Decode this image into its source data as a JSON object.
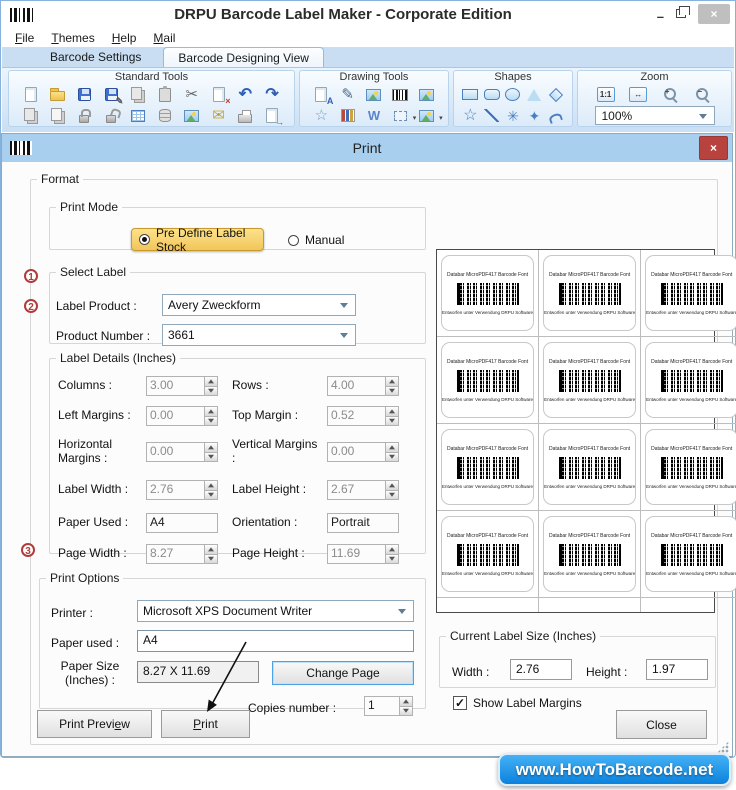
{
  "window": {
    "title": "DRPU Barcode Label Maker - Corporate Edition",
    "menu": [
      {
        "label": "File",
        "u": 0
      },
      {
        "label": "Themes",
        "u": 0
      },
      {
        "label": "Help",
        "u": 0
      },
      {
        "label": "Mail",
        "u": 0
      }
    ],
    "tabs": [
      {
        "label": "Barcode Settings",
        "active": false
      },
      {
        "label": "Barcode Designing View",
        "active": true
      }
    ]
  },
  "ribbon": {
    "groups": [
      {
        "label": "Standard Tools",
        "rows": [
          [
            "new-document",
            "open",
            "save",
            "save-as",
            "copy",
            "paste",
            "cut",
            "delete",
            "undo",
            "redo"
          ],
          [
            "bring-to-front",
            "send-to-back",
            "lock",
            "unlock",
            "grid",
            "database",
            "image-export",
            "email",
            "print",
            "export"
          ]
        ]
      },
      {
        "label": "Drawing Tools",
        "rows": [
          [
            "text-tool",
            "pencil-tool",
            "image-tool",
            "barcode-tool",
            "picture-insert"
          ],
          [
            "shape-tool",
            "library",
            "watermark",
            "frame-tool",
            "image-gallery"
          ]
        ]
      },
      {
        "label": "Shapes",
        "rows": [
          [
            "rectangle",
            "rounded-rectangle",
            "ellipse",
            "triangle",
            "diamond"
          ],
          [
            "star",
            "line",
            "starburst",
            "four-point-star",
            "arc"
          ]
        ]
      }
    ],
    "zoom": {
      "label": "Zoom",
      "buttons": [
        "zoom-one-to-one",
        "zoom-fit",
        "zoom-in",
        "zoom-out"
      ],
      "one_to_one_label": "1:1",
      "level": "100%"
    }
  },
  "dialog": {
    "title": "Print",
    "format_legend": "Format",
    "print_mode": {
      "legend": "Print Mode",
      "options": [
        {
          "label": "Pre Define Label Stock",
          "selected": true
        },
        {
          "label": "Manual",
          "selected": false
        }
      ]
    },
    "select_label": {
      "legend": "Select Label",
      "marker1": "1",
      "marker2": "2",
      "label_product": {
        "label": "Label Product :",
        "value": "Avery Zweckform"
      },
      "product_number": {
        "label": "Product Number :",
        "value": "3661"
      }
    },
    "label_details": {
      "legend": "Label Details (Inches)",
      "fields": [
        {
          "id": "columns",
          "label": "Columns :",
          "value": "3.00",
          "type": "spin"
        },
        {
          "id": "rows",
          "label": "Rows :",
          "value": "4.00",
          "type": "spin"
        },
        {
          "id": "left-margins",
          "label": "Left Margins :",
          "value": "0.00",
          "type": "spin"
        },
        {
          "id": "top-margin",
          "label": "Top Margin :",
          "value": "0.52",
          "type": "spin"
        },
        {
          "id": "horizontal-margins",
          "label": "Horizontal Margins :",
          "value": "0.00",
          "type": "spin"
        },
        {
          "id": "vertical-margins",
          "label": "Vertical Margins :",
          "value": "0.00",
          "type": "spin"
        },
        {
          "id": "label-width",
          "label": "Label Width :",
          "value": "2.76",
          "type": "spin"
        },
        {
          "id": "label-height",
          "label": "Label Height :",
          "value": "2.67",
          "type": "spin"
        },
        {
          "id": "paper-used",
          "label": "Paper Used :",
          "value": "A4",
          "type": "text"
        },
        {
          "id": "orientation",
          "label": "Orientation :",
          "value": "Portrait",
          "type": "text"
        },
        {
          "id": "page-width",
          "label": "Page Width :",
          "value": "8.27",
          "type": "spin"
        },
        {
          "id": "page-height",
          "label": "Page Height :",
          "value": "11.69",
          "type": "spin"
        }
      ]
    },
    "print_options": {
      "legend": "Print Options",
      "marker": "3",
      "printer": {
        "label": "Printer :",
        "value": "Microsoft XPS Document Writer"
      },
      "paper_used": {
        "label": "Paper used :",
        "value": "A4"
      },
      "paper_size": {
        "label": "Paper Size (Inches) :",
        "value": "8.27 X 11.69"
      },
      "change_page_label": "Change Page",
      "copies": {
        "label": "Copies number :",
        "value": "1"
      }
    },
    "buttons": {
      "print_preview": {
        "label": "Print Preview",
        "u": 11
      },
      "print": {
        "label": "Print",
        "u": 0
      },
      "close": {
        "label": "Close",
        "u": -1
      }
    },
    "preview": {
      "rows": 4,
      "cols": 3,
      "card": {
        "line1": "Databar MicroPDF417 Barcode Font",
        "line2": "Entworfen unter Verwendung DRPU Software"
      }
    },
    "current_label_size": {
      "legend": "Current Label Size (Inches)",
      "width": {
        "label": "Width :",
        "value": "2.76"
      },
      "height": {
        "label": "Height :",
        "value": "1.97"
      }
    },
    "show_label_margins": {
      "label": "Show Label Margins",
      "checked": true
    }
  },
  "badge": {
    "text": "www.HowToBarcode.net"
  },
  "colors": {
    "accent_blue": "#0c82dd",
    "dialog_titlebar": "#a8cfed",
    "close_red": "#b8423e",
    "highlight_yellow": "#f1c65a",
    "marker_red": "#b23c3c"
  }
}
